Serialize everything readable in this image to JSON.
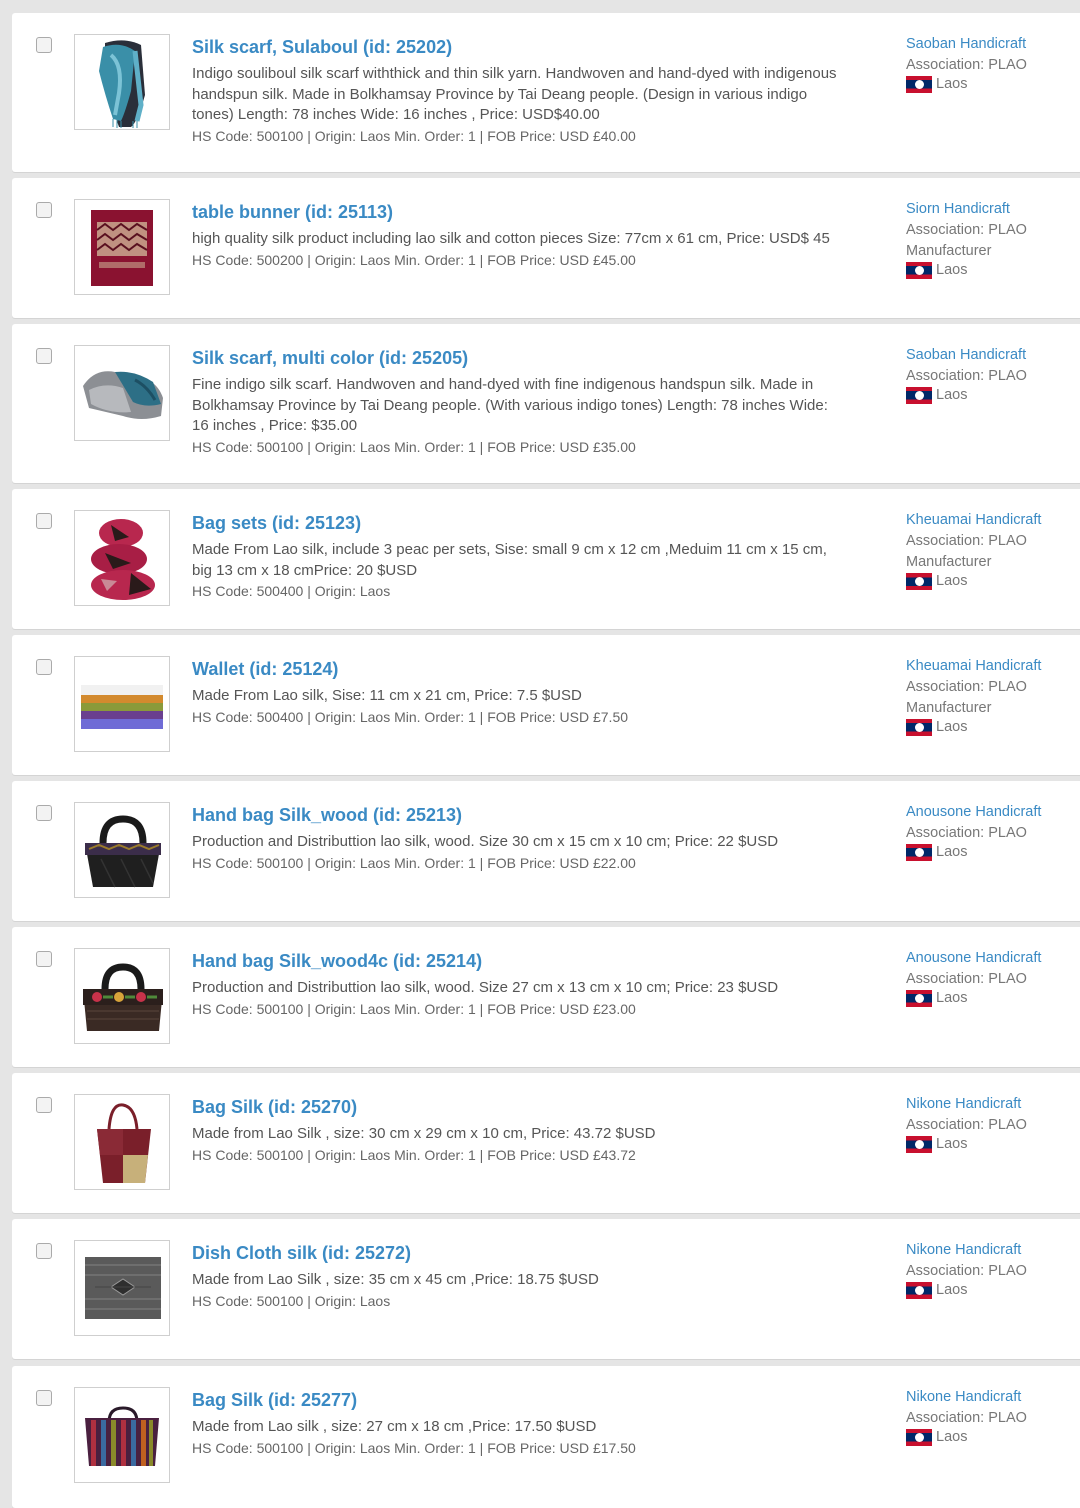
{
  "products": [
    {
      "title": "Silk scarf, Sulaboul (id: 25202)",
      "description": "Indigo souliboul silk scarf withthick and thin silk yarn. Handwoven and hand-dyed with indigenous handspun silk. Made in Bolkhamsay Province by Tai Deang people. (Design in various indigo tones) Length: 78 inches Wide: 16 inches , Price: USD$40.00",
      "meta": "HS Code: 500100  |  Origin: Laos Min. Order: 1  |  FOB Price: USD £40.00",
      "seller": "Saoban Handicraft",
      "association": "Association: PLAO",
      "type": "",
      "country": "Laos",
      "image_icon": "scarf-image"
    },
    {
      "title": "table bunner (id: 25113)",
      "description": "high quality silk product including lao silk and cotton pieces Size: 77cm x 61 cm, Price: USD$ 45",
      "meta": "HS Code: 500200  |  Origin: Laos Min. Order: 1  |  FOB Price: USD £45.00",
      "seller": "Siorn Handicraft",
      "association": "Association: PLAO",
      "type": "Manufacturer",
      "country": "Laos",
      "image_icon": "table-runner-image"
    },
    {
      "title": "Silk scarf, multi color (id: 25205)",
      "description": "Fine indigo silk scarf. Handwoven and hand-dyed with fine indigenous handspun silk. Made in Bolkhamsay Province by Tai Deang people. (With various indigo tones) Length: 78 inches Wide: 16 inches , Price: $35.00",
      "meta": "HS Code: 500100  |  Origin: Laos Min. Order: 1  |  FOB Price: USD £35.00",
      "seller": "Saoban Handicraft",
      "association": "Association: PLAO",
      "type": "",
      "country": "Laos",
      "image_icon": "folded-scarf-image"
    },
    {
      "title": "Bag sets (id: 25123)",
      "description": "Made From Lao silk, include 3 peac per sets, Sise: small 9 cm x 12 cm ,Meduim 11 cm x 15 cm, big 13 cm x 18 cmPrice: 20 $USD",
      "meta": "HS Code: 500400  |  Origin: Laos",
      "seller": "Kheuamai Handicraft",
      "association": "Association: PLAO",
      "type": "Manufacturer",
      "country": "Laos",
      "image_icon": "pouch-set-image"
    },
    {
      "title": "Wallet (id: 25124)",
      "description": "Made From Lao silk, Sise: 11 cm x 21 cm, Price: 7.5 $USD",
      "meta": "HS Code: 500400  |  Origin: Laos Min. Order: 1  |  FOB Price: USD £7.50",
      "seller": "Kheuamai Handicraft",
      "association": "Association: PLAO",
      "type": "Manufacturer",
      "country": "Laos",
      "image_icon": "wallet-image"
    },
    {
      "title": "Hand bag Silk_wood (id: 25213)",
      "description": "Production and Distributtion lao silk, wood. Size 30 cm x 15 cm x 10 cm; Price: 22 $USD",
      "meta": "HS Code: 500100  |  Origin: Laos Min. Order: 1  |  FOB Price: USD £22.00",
      "seller": "Anousone Handicraft",
      "association": "Association: PLAO",
      "type": "",
      "country": "Laos",
      "image_icon": "handbag-image"
    },
    {
      "title": "Hand bag Silk_wood4c (id: 25214)",
      "description": "Production and Distributtion lao silk, wood. Size 27 cm x 13 cm x 10 cm; Price: 23 $USD",
      "meta": "HS Code: 500100  |  Origin: Laos Min. Order: 1  |  FOB Price: USD £23.00",
      "seller": "Anousone Handicraft",
      "association": "Association: PLAO",
      "type": "",
      "country": "Laos",
      "image_icon": "floral-handbag-image"
    },
    {
      "title": "Bag Silk (id: 25270)",
      "description": "Made from Lao Silk , size: 30 cm x 29 cm x 10 cm, Price: 43.72 $USD",
      "meta": "HS Code: 500100  |  Origin: Laos Min. Order: 1  |  FOB Price: USD £43.72",
      "seller": "Nikone Handicraft",
      "association": "Association: PLAO",
      "type": "",
      "country": "Laos",
      "image_icon": "tote-bag-image"
    },
    {
      "title": "Dish Cloth silk (id: 25272)",
      "description": "Made from Lao Silk , size: 35 cm x 45 cm ,Price: 18.75 $USD",
      "meta": "HS Code: 500100  |  Origin: Laos",
      "seller": "Nikone Handicraft",
      "association": "Association: PLAO",
      "type": "",
      "country": "Laos",
      "image_icon": "dish-cloth-image"
    },
    {
      "title": "Bag Silk (id: 25277)",
      "description": "Made from Lao silk , size: 27 cm x 18 cm ,Price: 17.50 $USD",
      "meta": "HS Code: 500100  |  Origin: Laos Min. Order: 1  |  FOB Price: USD £17.50",
      "seller": "Nikone Handicraft",
      "association": "Association: PLAO",
      "type": "",
      "country": "Laos",
      "image_icon": "striped-bag-image"
    }
  ],
  "colors": {
    "link": "#3a8ac4",
    "text": "#555555",
    "background": "#e5e5e5"
  }
}
